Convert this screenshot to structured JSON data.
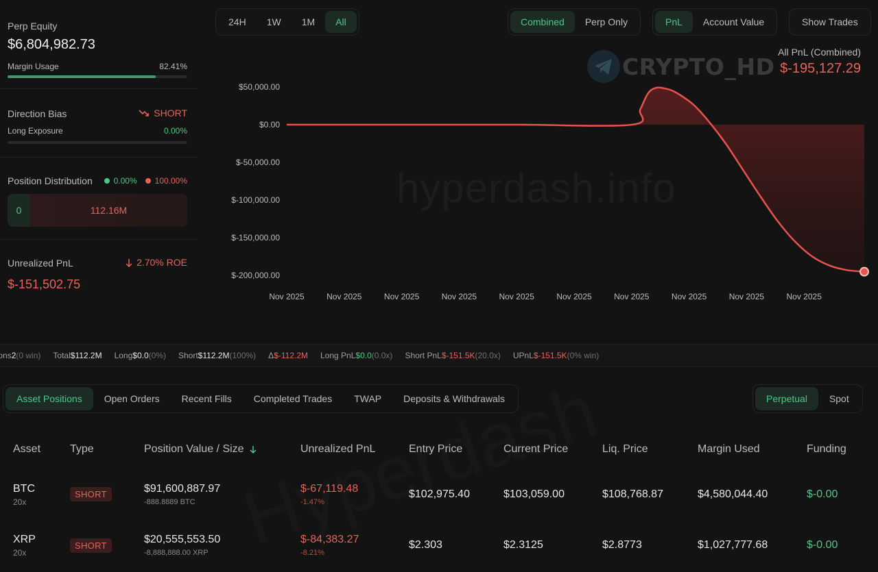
{
  "left": {
    "perp_equity_label": "Perp Equity",
    "perp_equity_value": "$6,804,982.73",
    "margin_usage_label": "Margin Usage",
    "margin_usage_value": "82.41%",
    "margin_usage_fraction": 0.8241,
    "direction_bias_label": "Direction Bias",
    "direction_bias_value": "SHORT",
    "long_exposure_label": "Long Exposure",
    "long_exposure_value": "0.00%",
    "long_exposure_fraction": 0,
    "position_distribution_label": "Position Distribution",
    "dist_long_pct": "0.00%",
    "dist_short_pct": "100.00%",
    "dist_long_value": "0",
    "dist_short_value": "112.16M",
    "unrealized_pnl_label": "Unrealized PnL",
    "unrealized_roe": "2.70% ROE",
    "unrealized_pnl_value": "$-151,502.75"
  },
  "chart_controls": {
    "ranges": [
      "24H",
      "1W",
      "1M",
      "All"
    ],
    "active_range": "All",
    "mode": [
      "Combined",
      "Perp Only"
    ],
    "active_mode": "Combined",
    "metric": [
      "PnL",
      "Account Value"
    ],
    "active_metric": "PnL",
    "show_trades": "Show Trades"
  },
  "chart_header": {
    "label": "All PnL (Combined)",
    "value": "$-195,127.29"
  },
  "watermarks": {
    "brand": "CRYPTO_HD",
    "site": "hyperdash.info",
    "table": "Hyperdash"
  },
  "chart_data": {
    "type": "area",
    "x_ticks": [
      "Nov 2025",
      "Nov 2025",
      "Nov 2025",
      "Nov 2025",
      "Nov 2025",
      "Nov 2025",
      "Nov 2025",
      "Nov 2025",
      "Nov 2025",
      "Nov 2025"
    ],
    "y_ticks": [
      "$50,000.00",
      "$0.00",
      "$-50,000.00",
      "$-100,000.00",
      "$-150,000.00",
      "$-200,000.00"
    ],
    "y_tick_values": [
      50000,
      0,
      -50000,
      -100000,
      -150000,
      -200000
    ],
    "ylim": [
      -200000,
      50000
    ],
    "x": [
      0,
      0.2,
      0.4,
      0.598,
      0.612,
      0.626,
      0.64,
      0.655,
      0.668,
      0.684,
      0.705,
      0.73,
      0.76,
      0.79,
      0.82,
      0.85,
      0.88,
      0.91,
      0.94,
      0.97,
      1.0
    ],
    "y": [
      0,
      0,
      0,
      0,
      20000,
      42000,
      49000,
      48000,
      45000,
      38000,
      26000,
      5000,
      -25000,
      -60000,
      -95000,
      -128000,
      -155000,
      -175000,
      -187000,
      -193000,
      -195127.29
    ],
    "color": "#e8544d",
    "grid": false,
    "legend": "none"
  },
  "stats": [
    {
      "label": "Positions",
      "value": "2",
      "sub": "(0 win)",
      "color": "#e6e6e6"
    },
    {
      "label": "Total",
      "value": "$112.2M",
      "sub": "",
      "color": "#e6e6e6"
    },
    {
      "label": "Long",
      "value": "$0.0",
      "sub": "(0%)",
      "color": "#e6e6e6"
    },
    {
      "label": "Short",
      "value": "$112.2M",
      "sub": "(100%)",
      "color": "#e6e6e6"
    },
    {
      "label": "Δ",
      "value": "$-112.2M",
      "sub": "",
      "color": "#e8635a"
    },
    {
      "label": "Long PnL",
      "value": "$0.0",
      "sub": "(0.0x)",
      "color": "#4fc78a"
    },
    {
      "label": "Short PnL",
      "value": "$-151.5K",
      "sub": "(20.0x)",
      "color": "#e8635a"
    },
    {
      "label": "UPnL",
      "value": "$-151.5K",
      "sub": "(0% win)",
      "color": "#e8635a"
    }
  ],
  "tabs": [
    "Asset Positions",
    "Open Orders",
    "Recent Fills",
    "Completed Trades",
    "TWAP",
    "Deposits & Withdrawals"
  ],
  "active_tab": "Asset Positions",
  "market_tabs": [
    "Perpetual",
    "Spot"
  ],
  "active_market": "Perpetual",
  "table": {
    "headers": [
      "Asset",
      "Type",
      "Position Value / Size",
      "Unrealized PnL",
      "Entry Price",
      "Current Price",
      "Liq. Price",
      "Margin Used",
      "Funding"
    ],
    "rows": [
      {
        "asset": "BTC",
        "leverage": "20x",
        "type": "SHORT",
        "value": "$91,600,887.97",
        "size": "-888.8889 BTC",
        "upnl": "$-67,119.48",
        "upnl_pct": "-1.47%",
        "entry": "$102,975.40",
        "current": "$103,059.00",
        "liq": "$108,768.87",
        "margin": "$4,580,044.40",
        "funding": "$-0.00"
      },
      {
        "asset": "XRP",
        "leverage": "20x",
        "type": "SHORT",
        "value": "$20,555,553.50",
        "size": "-8,888,888.00 XRP",
        "upnl": "$-84,383.27",
        "upnl_pct": "-8.21%",
        "entry": "$2.303",
        "current": "$2.3125",
        "liq": "$2.8773",
        "margin": "$1,027,777.68",
        "funding": "$-0.00"
      }
    ]
  }
}
